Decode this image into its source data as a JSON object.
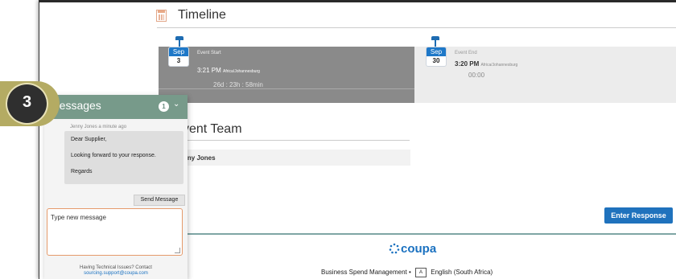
{
  "timeline": {
    "title": "Timeline"
  },
  "event_start": {
    "month": "Sep",
    "day": "3",
    "label": "Event Start",
    "time": "3:21 PM",
    "timezone": "Africa/Johannesburg",
    "countdown": "26d : 23h : 58min"
  },
  "event_end": {
    "month": "Sep",
    "day": "30",
    "label": "Event End",
    "time": "3:20 PM",
    "timezone": "Africa/Johannesburg",
    "countdown": "00:00"
  },
  "team": {
    "title": "Event Team",
    "title_visible": "vent Team",
    "member": "nny Jones",
    "member_full": "Jenny Jones"
  },
  "actions": {
    "enter_response": "Enter Response"
  },
  "footer": {
    "brand": "coupa",
    "tagline": "Business Spend Management",
    "separator": "•",
    "language": "English (South Africa)"
  },
  "messages": {
    "title": "Messages",
    "unread_count": "1",
    "sender_line": "Jenny Jones a minute ago",
    "body": [
      "Dear Supplier,",
      "Looking forward to your response.",
      "Regards"
    ],
    "send_label": "Send Message",
    "placeholder": "Type new message",
    "help_text": "Having Technical Issues? Contact",
    "help_email": "sourcing.support@coupa.com"
  },
  "step_badge": {
    "number": "3"
  },
  "colors": {
    "accent_blue": "#1f72bd",
    "messages_header": "#779a8a",
    "badge_gold": "#b4ab63",
    "input_border": "#e59a6b"
  }
}
